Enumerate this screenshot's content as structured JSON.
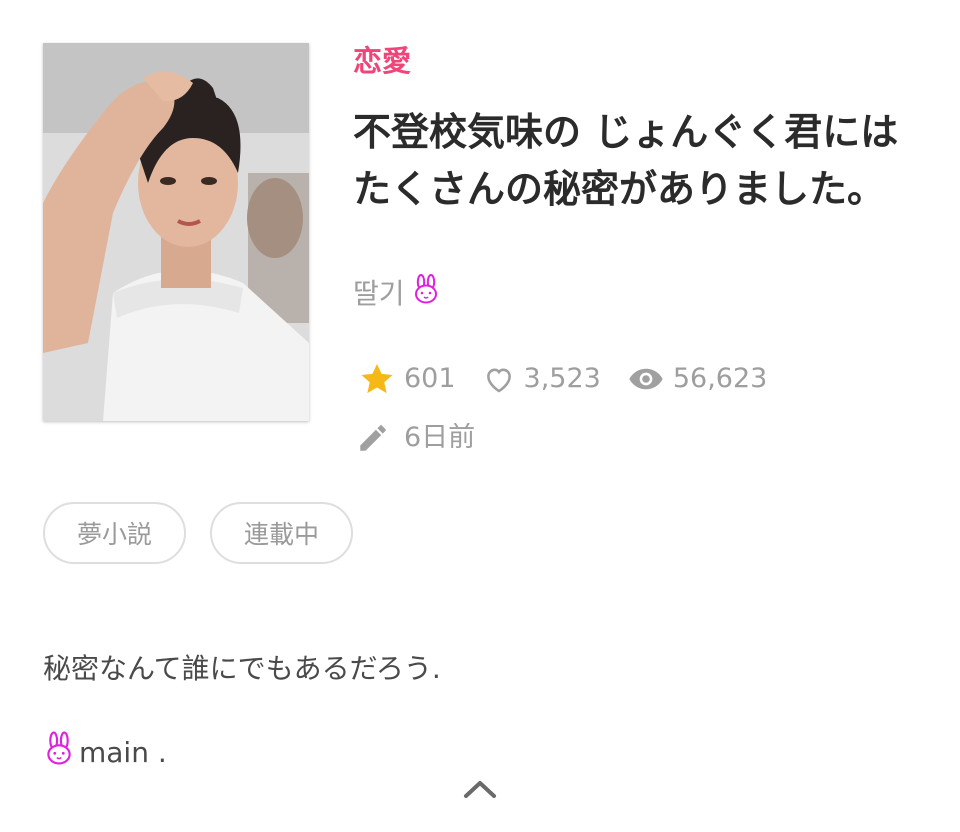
{
  "story": {
    "genre": "恋愛",
    "title": "不登校気味の じょんぐく君には たくさんの秘密がありました。",
    "author": "딸기",
    "author_emoji_icon": "rabbit-face-icon",
    "stats": {
      "stars": "601",
      "likes": "3,523",
      "views": "56,623"
    },
    "updated": "6日前",
    "tags": [
      "夢小説",
      "連載中"
    ],
    "description": {
      "line1": "秘密なんて誰にでもあるだろう.",
      "line2": "main ."
    }
  },
  "colors": {
    "genre": "#f0447a",
    "star": "#f5b817",
    "muted": "#9e9e9e",
    "rabbit": "#e020e0"
  },
  "icons": {
    "star": "star-icon",
    "like": "heart-outline-icon",
    "views": "eye-icon",
    "updated": "pencil-icon",
    "collapse": "chevron-up-icon"
  }
}
